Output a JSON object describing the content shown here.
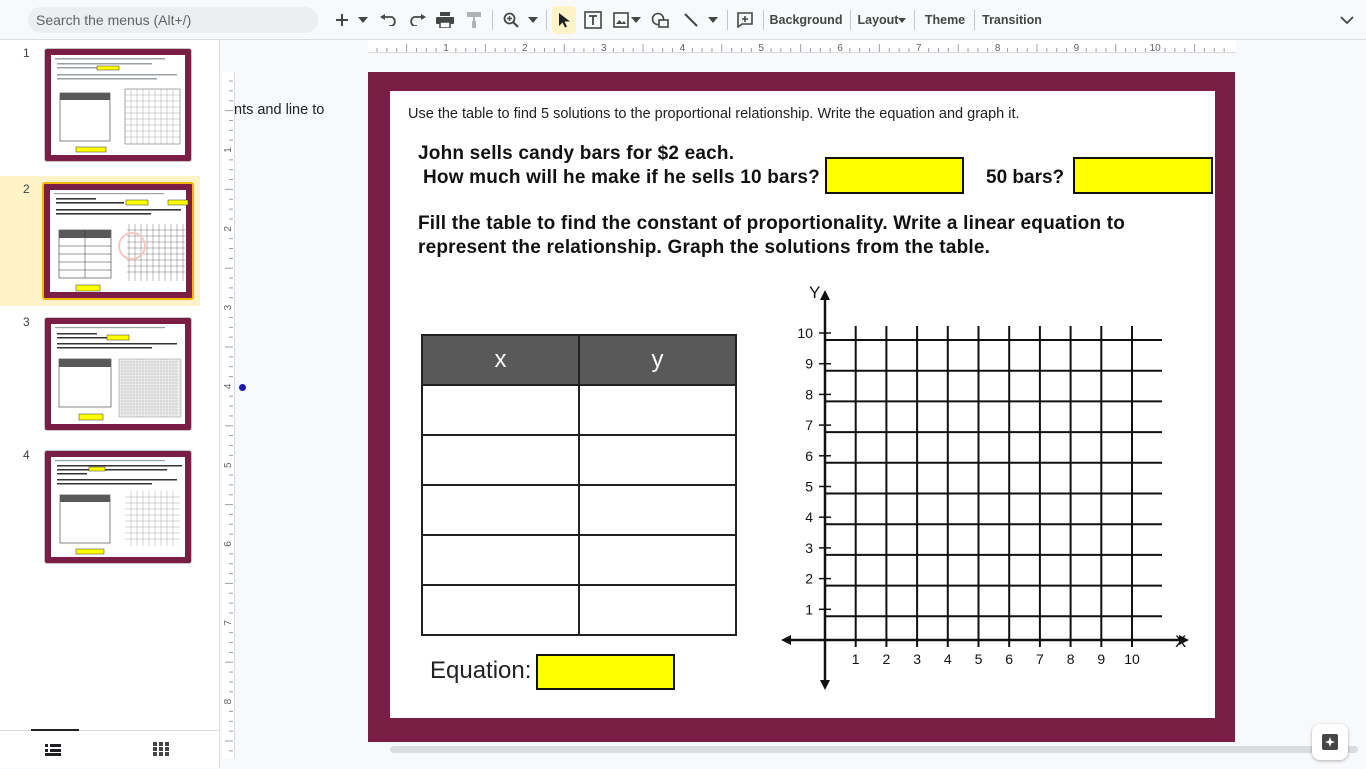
{
  "toolbar": {
    "search_placeholder": "Search the menus (Alt+/)",
    "background_label": "Background",
    "layout_label": "Layout",
    "theme_label": "Theme",
    "transition_label": "Transition"
  },
  "filmstrip": {
    "slides": [
      {
        "number": "1",
        "selected": false
      },
      {
        "number": "2",
        "selected": true
      },
      {
        "number": "3",
        "selected": false
      },
      {
        "number": "4",
        "selected": false
      }
    ]
  },
  "ruler": {
    "top_numbers": [
      "1",
      "2",
      "3",
      "4",
      "5",
      "6",
      "7",
      "8",
      "9",
      "10"
    ],
    "left_numbers": [
      "1",
      "2",
      "3",
      "4",
      "5",
      "6",
      "7",
      "8"
    ]
  },
  "notes_snippet": "nts and line to",
  "slide": {
    "instruction": "Use the table to find 5 solutions to the proportional relationship. Write the equation and graph it.",
    "question_line1": "John sells candy bars for $2 each.",
    "question_line2": "How much will he make if he sells 10 bars?",
    "question_line3": "50 bars?",
    "fill_line1": "Fill the table to find the constant of proportionality. Write a linear equation to",
    "fill_line2": "represent the relationship. Graph the solutions from the table.",
    "table_headers": [
      "x",
      "y"
    ],
    "table_rows": 5,
    "equation_label": "Equation:",
    "answer_box_color": "#ffff00",
    "border_color": "#7a1e45",
    "graph": {
      "x_label": "X",
      "y_label": "Y",
      "x_ticks": [
        "1",
        "2",
        "3",
        "4",
        "5",
        "6",
        "7",
        "8",
        "9",
        "10"
      ],
      "y_ticks": [
        "1",
        "2",
        "3",
        "4",
        "5",
        "6",
        "7",
        "8",
        "9",
        "10"
      ]
    }
  }
}
